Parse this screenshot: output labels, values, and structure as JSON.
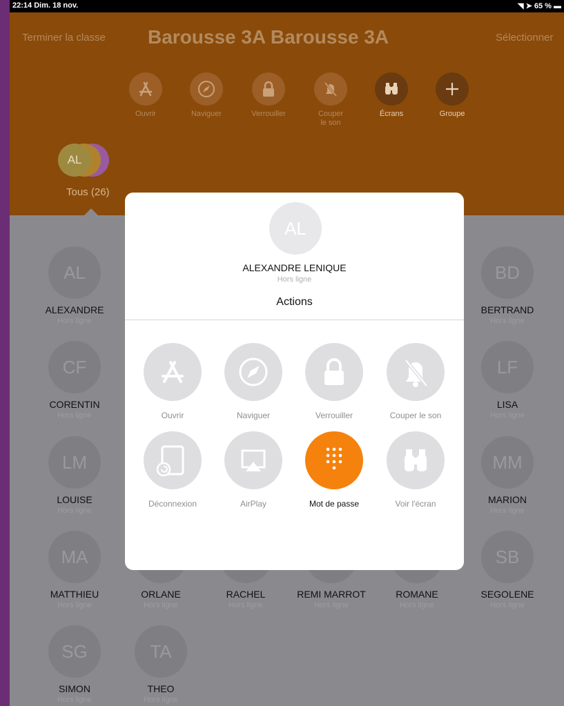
{
  "status_bar": {
    "time_date": "22:14  Dim. 18 nov.",
    "battery": "65 %"
  },
  "header": {
    "end_class_label": "Terminer la classe",
    "title": "Barousse 3A Barousse 3A",
    "select_label": "Sélectionner"
  },
  "toolbar": [
    {
      "label": "Ouvrir",
      "icon": "app-store-icon"
    },
    {
      "label": "Naviguer",
      "icon": "compass-icon"
    },
    {
      "label": "Verrouiller",
      "icon": "lock-icon"
    },
    {
      "label": "Couper le son",
      "icon": "mute-bell-icon"
    },
    {
      "label": "Écrans",
      "icon": "binoculars-icon"
    },
    {
      "label": "Groupe",
      "icon": "plus-icon"
    }
  ],
  "group": {
    "label": "Tous (26)",
    "avatar_initials": "AL"
  },
  "students": [
    {
      "initials": "AL",
      "name": "ALEXANDRE",
      "status": "Hors ligne"
    },
    {
      "initials": "BD",
      "name": "BERTRAND",
      "status": "Hors ligne"
    },
    {
      "initials": "CF",
      "name": "CORENTIN",
      "status": "Hors ligne"
    },
    {
      "initials": "LF",
      "name": "LISA",
      "status": "Hors ligne"
    },
    {
      "initials": "LM",
      "name": "LOUISE",
      "status": "Hors ligne"
    },
    {
      "initials": "MM",
      "name": "MARION",
      "status": "Hors ligne"
    },
    {
      "initials": "MA",
      "name": "MATTHIEU",
      "status": "Hors ligne"
    },
    {
      "initials": "",
      "name": "ORLANE",
      "status": "Hors ligne"
    },
    {
      "initials": "",
      "name": "RACHEL",
      "status": "Hors ligne"
    },
    {
      "initials": "",
      "name": "REMI MARROT",
      "status": "Hors ligne"
    },
    {
      "initials": "",
      "name": "ROMANE",
      "status": "Hors ligne"
    },
    {
      "initials": "SB",
      "name": "SEGOLENE",
      "status": "Hors ligne"
    },
    {
      "initials": "SG",
      "name": "SIMON",
      "status": "Hors ligne"
    },
    {
      "initials": "TA",
      "name": "THEO",
      "status": "Hors ligne"
    }
  ],
  "modal": {
    "avatar_initials": "AL",
    "student_name": "ALEXANDRE LENIQUE",
    "student_status": "Hors ligne",
    "title": "Actions",
    "actions": [
      {
        "label": "Ouvrir",
        "icon": "app-store-icon"
      },
      {
        "label": "Naviguer",
        "icon": "compass-icon"
      },
      {
        "label": "Verrouiller",
        "icon": "lock-icon"
      },
      {
        "label": "Couper le son",
        "icon": "mute-bell-icon"
      },
      {
        "label": "Déconnexion",
        "icon": "logout-tablet-icon"
      },
      {
        "label": "AirPlay",
        "icon": "airplay-icon"
      },
      {
        "label": "Mot de passe",
        "icon": "keypad-icon",
        "selected": true,
        "accent": "#f5820d"
      },
      {
        "label": "Voir l'écran",
        "icon": "binoculars-icon"
      }
    ]
  },
  "colors": {
    "header_bg": "#8a4a0a",
    "backdrop": "#8a8a8e",
    "accent": "#f5820d",
    "frame": "#6b2d74"
  }
}
